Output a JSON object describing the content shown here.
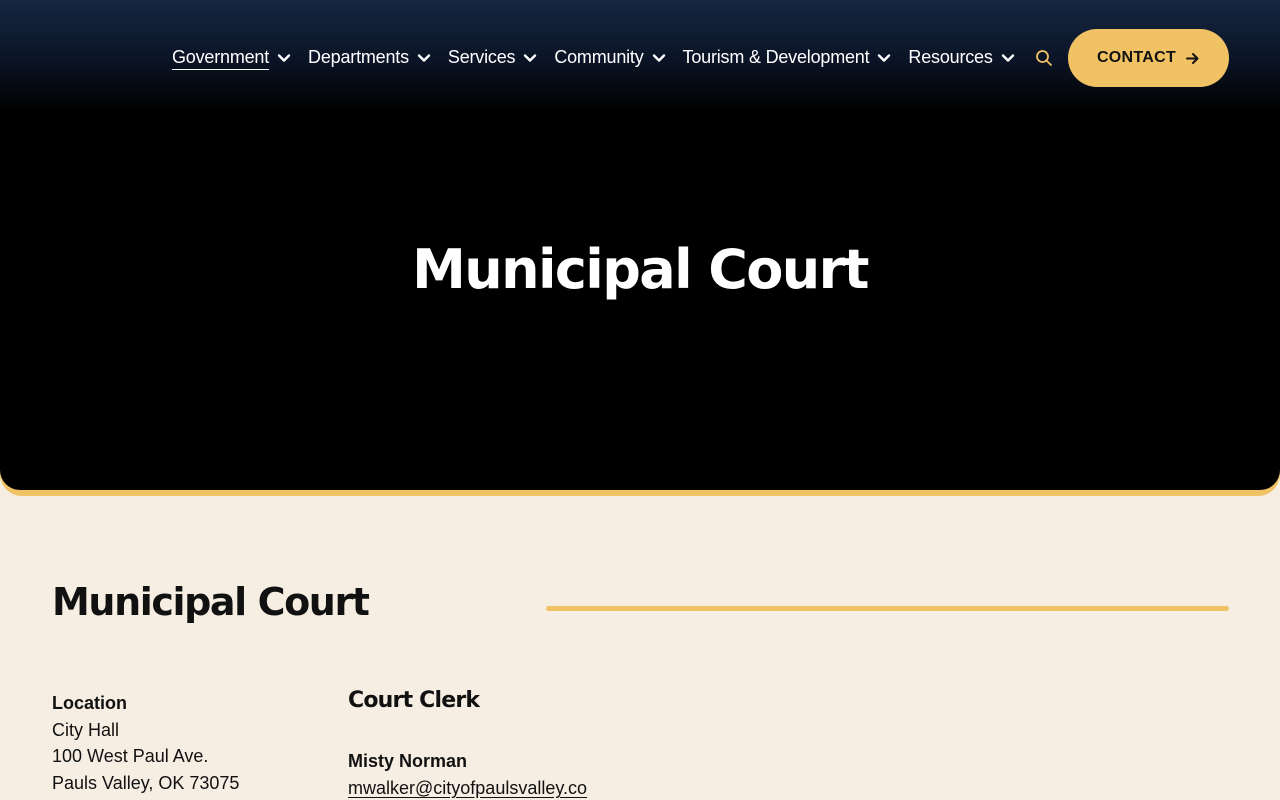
{
  "nav": {
    "items": [
      {
        "label": "Government",
        "active": true
      },
      {
        "label": "Departments"
      },
      {
        "label": "Services"
      },
      {
        "label": "Community"
      },
      {
        "label": "Tourism & Development"
      },
      {
        "label": "Resources"
      }
    ],
    "contact_label": "CONTACT"
  },
  "hero": {
    "title": "Municipal Court"
  },
  "section": {
    "title": "Municipal Court"
  },
  "location": {
    "heading": "Location",
    "lines": [
      "City Hall",
      "100 West Paul Ave.",
      "Pauls Valley, OK 73075"
    ]
  },
  "court_clerk": {
    "heading": "Court Clerk",
    "name": "Misty Norman",
    "email": "mwalker@cityofpaulsvalley.co"
  },
  "colors": {
    "accent": "#f1c264",
    "background": "#f6eee3",
    "hero": "#000000"
  }
}
